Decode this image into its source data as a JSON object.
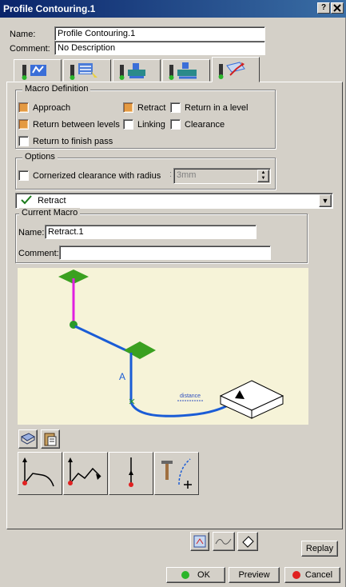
{
  "window": {
    "title": "Profile Contouring.1",
    "help_label": "?",
    "close_label": "x"
  },
  "header": {
    "name_label": "Name:",
    "name_value": "Profile Contouring.1",
    "comment_label": "Comment:",
    "comment_value": "No Description"
  },
  "tabs": [
    {
      "icon": "geometry-tab-icon"
    },
    {
      "icon": "strategy-tab-icon"
    },
    {
      "icon": "tool-tab-icon"
    },
    {
      "icon": "feeds-speeds-tab-icon"
    },
    {
      "icon": "macros-tab-icon",
      "active": true
    }
  ],
  "macro_definition": {
    "title": "Macro Definition",
    "items": [
      {
        "label": "Approach",
        "checked": true
      },
      {
        "label": "Retract",
        "checked": true
      },
      {
        "label": "Return in a level",
        "checked": false
      },
      {
        "label": "Return between levels",
        "checked": true
      },
      {
        "label": "Linking",
        "checked": false
      },
      {
        "label": "Clearance",
        "checked": false
      },
      {
        "label": "Return to finish pass",
        "checked": false
      }
    ]
  },
  "options": {
    "title": "Options",
    "cornerized_label": "Cornerized clearance with radius",
    "radius_value": "3mm"
  },
  "macro_select": {
    "value": "Retract"
  },
  "current_macro": {
    "title": "Current Macro",
    "name_label": "Name:",
    "name_value": "Retract.1",
    "comment_label": "Comment:",
    "comment_value": ""
  },
  "diagram": {
    "point_label": "A",
    "annotation": "distance"
  },
  "buttons": {
    "replay": "Replay",
    "ok": "OK",
    "preview": "Preview",
    "cancel": "Cancel"
  },
  "colors": {
    "titlebar": "#0a246a",
    "path": "#1a5cd6",
    "approach_seg": "#e020e0",
    "plane": "#3aa020",
    "diagram_bg": "#f6f3d8",
    "checked": "#e49a42"
  }
}
